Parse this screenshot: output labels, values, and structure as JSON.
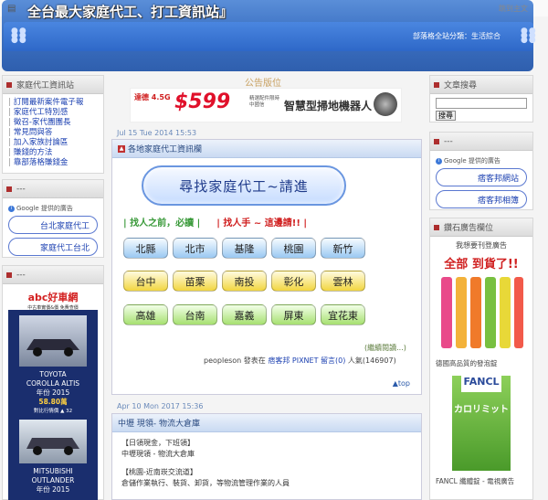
{
  "header": {
    "title": "全台最大家庭代工、打工資訊站』",
    "skip": "跳到主文",
    "category": "部落格全站分類：生活綜合"
  },
  "left": {
    "box1": {
      "title": "家庭代工資訊站",
      "links": [
        "訂閱最新案件電子報",
        "家庭代工特別感",
        "徵召-家代團團長",
        "常見問與答",
        "加入家族討論區",
        "賺錢的方法",
        "靠部落格賺錢金"
      ]
    },
    "box2": {
      "title": "---",
      "google": "Google 提供的廣告",
      "ads": [
        "台北家庭代工",
        "家庭代工台北"
      ]
    },
    "box3": {
      "title": "---",
      "abc": "abc好車網",
      "abc_sub": "中古車實價&價 免費查價",
      "car1": {
        "name": "TOYOTA",
        "model": "COROLLA ALTIS",
        "year": "年份 2015",
        "price": "58.80萬",
        "note": "對比行情價 ▲ 32"
      },
      "car2": {
        "name": "MITSUBISHI",
        "model": "OUTLANDER",
        "year": "年份 2015"
      }
    }
  },
  "center": {
    "ad_label": "公告版位",
    "banner": {
      "brand": "達德 4.5G",
      "price": "$599",
      "promo": "精選配件限時 中國信",
      "product": "智慧型掃地機器人"
    },
    "post1": {
      "date": "Jul 15 Tue 2014 15:53",
      "title": "各地家庭代工資訊欄",
      "find_banner": "尋找家庭代工~請進",
      "tag_green": "| 找人之前，必讀 |",
      "tag_red": "| 找人手 ~ 這邊請!! |",
      "rows": [
        [
          "北縣",
          "北市",
          "基隆",
          "桃園",
          "新竹"
        ],
        [
          "台中",
          "苗栗",
          "南投",
          "彰化",
          "雲林"
        ],
        [
          "高雄",
          "台南",
          "嘉義",
          "屏東",
          "宜花東"
        ]
      ],
      "more": "(繼續閱讀...)",
      "meta": {
        "author": "peopleson",
        "posted": "發表在",
        "platform": "痞客邦",
        "pixnet": "PIXNET",
        "comment": "留言(0)",
        "views": "人氣(146907)"
      },
      "top": "▲top"
    },
    "post2": {
      "date": "Apr 10 Mon 2017 15:36",
      "title": "中壢 現領- 物流大倉庫",
      "lines": [
        "【日領現金，下班領】",
        "中壢現領 - 物流大倉庫",
        "",
        "【桃園-近南崁交流道】",
        "倉儲作業執行、裝貨、卸貨，等物流管理作業的人員"
      ]
    }
  },
  "right": {
    "search": {
      "title": "文章搜尋",
      "button": "搜尋"
    },
    "box2": {
      "title": "---",
      "google": "Google 提供的廣告",
      "ads": [
        "痞客邦網站",
        "痞客邦相簿"
      ]
    },
    "box3": {
      "title": "鑽石廣告欄位",
      "lead": "我想要刊登廣告",
      "headline": "全部 到貨了!!",
      "caption1": "德國高品質的發泡錠",
      "fancl": "FANCL",
      "fancl_jp": "カロリミット",
      "caption2": "FANCL 纖體錠 - 電視廣告"
    }
  }
}
